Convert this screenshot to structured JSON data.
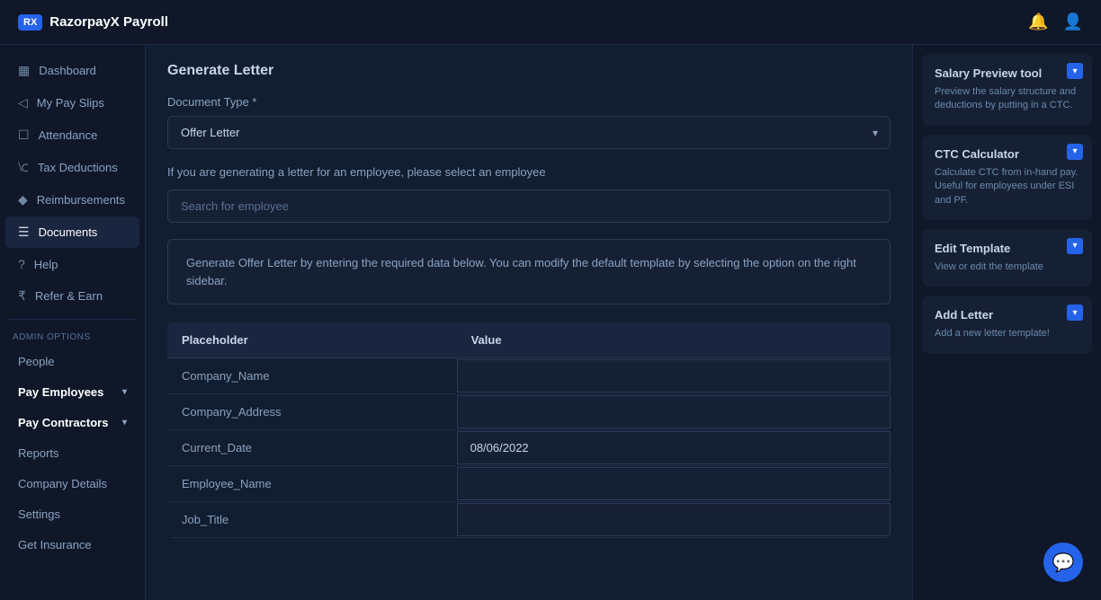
{
  "header": {
    "logo_text": "RazorpayX",
    "logo_sub": "Payroll",
    "logo_icon": "RX"
  },
  "sidebar": {
    "items": [
      {
        "id": "dashboard",
        "label": "Dashboard",
        "icon": "▦"
      },
      {
        "id": "my-pay-slips",
        "label": "My Pay Slips",
        "icon": "◁"
      },
      {
        "id": "attendance",
        "label": "Attendance",
        "icon": "☐"
      },
      {
        "id": "tax-deductions",
        "label": "Tax Deductions",
        "icon": "⟈"
      },
      {
        "id": "reimbursements",
        "label": "Reimbursements",
        "icon": "◆"
      },
      {
        "id": "documents",
        "label": "Documents",
        "icon": "☰"
      },
      {
        "id": "help",
        "label": "Help",
        "icon": "?"
      },
      {
        "id": "refer-earn",
        "label": "Refer & Earn",
        "icon": "₹"
      }
    ],
    "admin_section_label": "ADMIN OPTIONS",
    "admin_items": [
      {
        "id": "people",
        "label": "People"
      },
      {
        "id": "pay-employees",
        "label": "Pay Employees",
        "expandable": true
      },
      {
        "id": "pay-contractors",
        "label": "Pay Contractors",
        "expandable": true
      },
      {
        "id": "reports",
        "label": "Reports"
      },
      {
        "id": "company-details",
        "label": "Company Details"
      },
      {
        "id": "settings",
        "label": "Settings"
      },
      {
        "id": "get-insurance",
        "label": "Get Insurance"
      }
    ]
  },
  "main": {
    "page_title": "Generate Letter",
    "form": {
      "document_type_label": "Document Type *",
      "document_type_value": "Offer Letter",
      "employee_search_label": "If you are generating a letter for an employee, please select an employee",
      "employee_search_placeholder": "Search for employee",
      "info_text": "Generate Offer Letter by entering the required data below. You can modify the default template by selecting the option on the right sidebar.",
      "table": {
        "col_placeholder": "Placeholder",
        "col_value": "Value",
        "rows": [
          {
            "placeholder": "Company_Name",
            "value": ""
          },
          {
            "placeholder": "Company_Address",
            "value": ""
          },
          {
            "placeholder": "Current_Date",
            "value": "08/06/2022"
          },
          {
            "placeholder": "Employee_Name",
            "value": ""
          },
          {
            "placeholder": "Job_Title",
            "value": ""
          }
        ]
      }
    }
  },
  "right_sidebar": {
    "tools": [
      {
        "id": "salary-preview",
        "title": "Salary Preview tool",
        "desc": "Preview the salary structure and deductions by putting in a CTC."
      },
      {
        "id": "ctc-calculator",
        "title": "CTC Calculator",
        "desc": "Calculate CTC from in-hand pay. Useful for employees under ESI and PF."
      },
      {
        "id": "edit-template",
        "title": "Edit Template",
        "desc": "View or edit the template"
      },
      {
        "id": "add-letter",
        "title": "Add Letter",
        "desc": "Add a new letter template!"
      }
    ]
  }
}
